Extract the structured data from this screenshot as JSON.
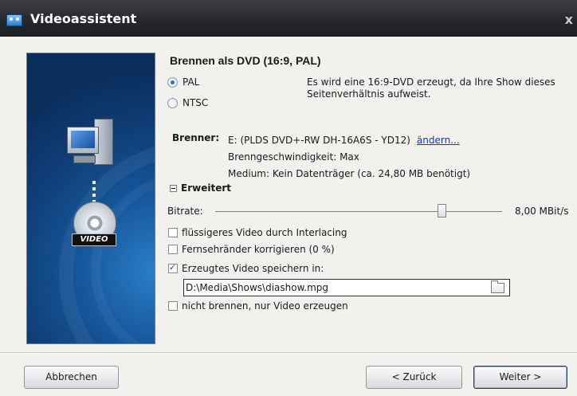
{
  "window": {
    "title": "Videoassistent",
    "close_label": "x"
  },
  "banner": {
    "video_label": "VIDEO"
  },
  "main": {
    "heading": "Brennen als DVD (16:9, PAL)",
    "standards": [
      {
        "label": "PAL",
        "checked": true
      },
      {
        "label": "NTSC",
        "checked": false
      }
    ],
    "info_text": "Es wird eine 16:9-DVD erzeugt, da Ihre Show dieses Seitenverhältnis aufweist.",
    "brenner": {
      "label": "Brenner:",
      "device": "E: (PLDS DVD+-RW DH-16A6S - YD12)",
      "change_link": "ändern...",
      "speed": "Brenngeschwindigkeit: Max",
      "medium": "Medium: Kein Datenträger (ca. 24,80 MB benötigt)"
    },
    "advanced_label": "Erweitert",
    "bitrate": {
      "label": "Bitrate:",
      "value": "8,00 MBit/s",
      "slider_fraction": 0.79
    },
    "options": [
      {
        "label": "flüssigeres Video durch Interlacing",
        "checked": false
      },
      {
        "label": "Fernsehränder korrigieren (0 %)",
        "checked": false
      },
      {
        "label": "Erzeugtes Video speichern in:",
        "checked": true
      },
      {
        "label": "nicht brennen, nur Video erzeugen",
        "checked": false
      }
    ],
    "save_path": "D:\\Media\\Shows\\diashow.mpg"
  },
  "footer": {
    "cancel_label": "Abbrechen",
    "back_label": "< Zurück",
    "next_label": "Weiter >"
  },
  "colors": {
    "titlebar": "#24262b",
    "link": "#1133cc",
    "banner": "#16569b"
  }
}
